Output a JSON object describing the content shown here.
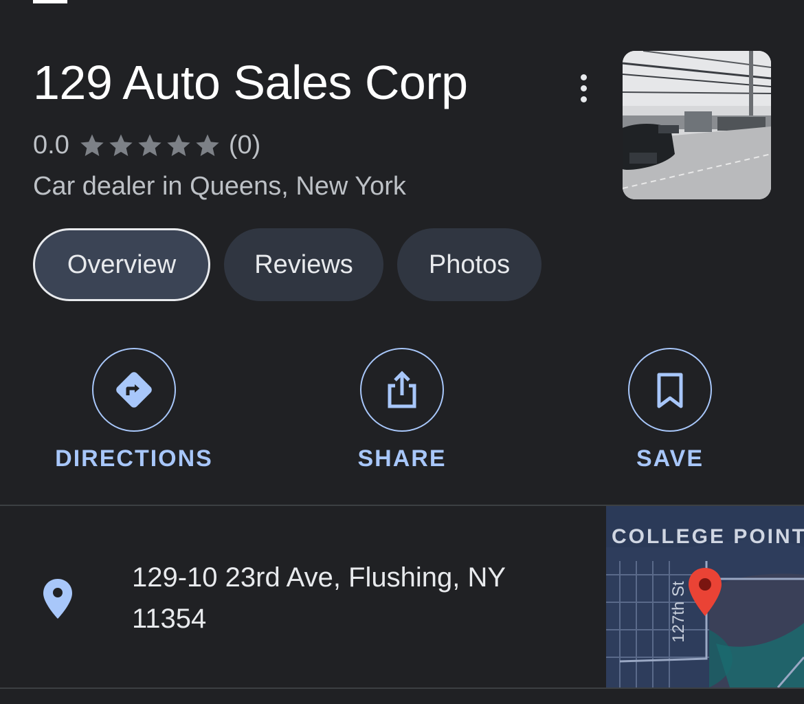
{
  "place": {
    "name": "129 Auto Sales Corp",
    "rating": "0.0",
    "stars": 5,
    "review_count": "(0)",
    "category": "Car dealer in Queens, New York"
  },
  "tabs": [
    {
      "label": "Overview",
      "active": true
    },
    {
      "label": "Reviews",
      "active": false
    },
    {
      "label": "Photos",
      "active": false
    }
  ],
  "actions": {
    "directions": "DIRECTIONS",
    "share": "SHARE",
    "save": "SAVE"
  },
  "address": {
    "text": "129-10 23rd Ave, Flushing, NY 11354"
  },
  "map": {
    "area_label": "COLLEGE POINT",
    "street_label": "127th St"
  },
  "colors": {
    "background": "#202124",
    "accent": "#a8c7fa",
    "pin": "#ea4335",
    "tab_bg": "#303641"
  },
  "icons": [
    "more-vert-icon",
    "star-icon",
    "directions-icon",
    "share-icon",
    "bookmark-icon",
    "location-pin-icon",
    "map-marker-icon"
  ]
}
